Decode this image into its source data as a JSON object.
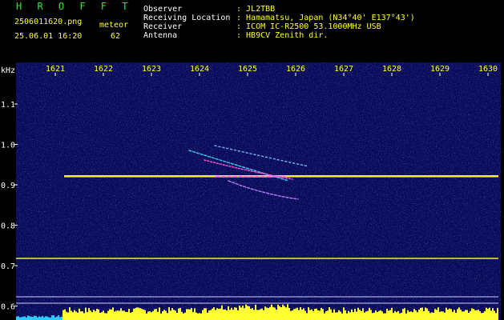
{
  "header": {
    "app_title": "H R O F F T",
    "filename": "2506011620.png",
    "mode": "meteor",
    "datetime": "25.06.01 16:20",
    "count": "62",
    "fields": [
      {
        "label": "Observer",
        "value": ": JL2TBB"
      },
      {
        "label": "Receiving Location",
        "value": ": Hamamatsu, Japan (N34°40' E137°43')"
      },
      {
        "label": "Receiver",
        "value": ": ICOM IC-R2500 53.1000MHz USB"
      },
      {
        "label": "Antenna",
        "value": ": HB9CV Zenith dir."
      }
    ]
  },
  "axis": {
    "unit": "kHz",
    "x_ticks": [
      "1621",
      "1622",
      "1623",
      "1624",
      "1625",
      "1626",
      "1627",
      "1628",
      "1629",
      "1630"
    ],
    "y_ticks": [
      "1.1",
      "1.0",
      "0.9",
      "0.8",
      "0.7",
      "0.6"
    ]
  },
  "colors": {
    "background": "#0a0a5a",
    "header_yellow": "#ffff30",
    "title_green": "#2ee82e",
    "carrier": "#e8f23a"
  }
}
